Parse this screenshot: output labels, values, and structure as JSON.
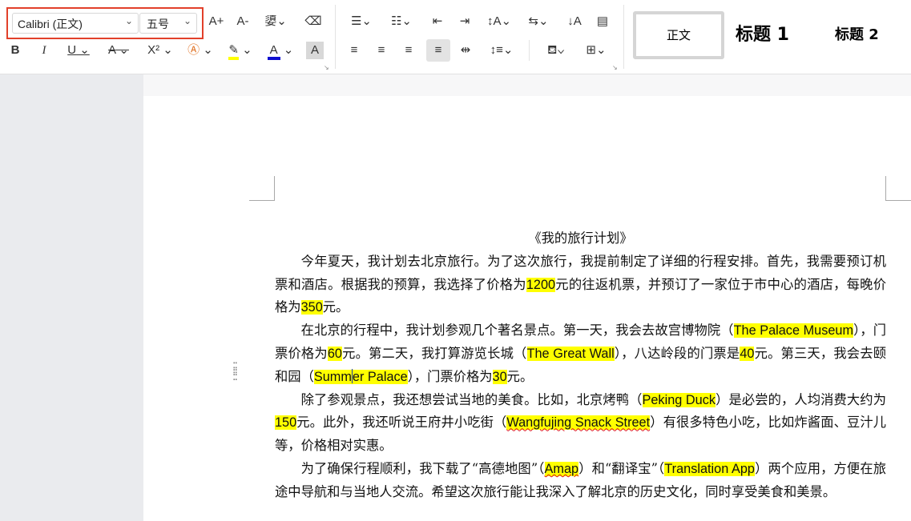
{
  "ribbon": {
    "font_name": "Calibri (正文)",
    "font_size": "五号",
    "grow_font_label": "A+",
    "shrink_font_label": "A-",
    "bold_label": "B",
    "italic_label": "I",
    "underline_label": "U",
    "strike_label": "A",
    "superscript_label": "X²",
    "font_color_label": "A",
    "char_shading_label": "A",
    "styles": [
      {
        "label": "正文"
      },
      {
        "label": "标题 1"
      },
      {
        "label": "标题 2"
      }
    ]
  },
  "document": {
    "title": "《我的旅行计划》",
    "p1": {
      "a": "今年夏天，我计划去北京旅行。为了这次旅行，我提前制定了详细的行程安排。首先，我需要预订机票和酒店。根据我的预算，我选择了价格为",
      "h1": "1200",
      "b": "元的往返机票，并预订了一家位于市中心的酒店，每晚价格为",
      "h2": "350",
      "c": "元。"
    },
    "p2": {
      "a": "在北京的行程中，我计划参观几个著名景点。第一天，我会去故宫博物院（",
      "h1": "The Palace Museum",
      "b": "），门票价格为",
      "h2": "60",
      "c": "元。第二天，我打算游览长城（",
      "h3": "The Great Wall",
      "d": "），八达岭段的门票是",
      "h4": "40",
      "e": "元。第三天，我会去颐和园（",
      "h5a": "Summ",
      "h5b": "er Palace",
      "f": "），门票价格为",
      "h6": "30",
      "g": "元。"
    },
    "p3": {
      "a": "除了参观景点，我还想尝试当地的美食。比如，北京烤鸭（",
      "h1": "Peking Duck",
      "b": "）是必尝的，人均消费大约为",
      "h2": "150",
      "c": "元。此外，我还听说王府井小吃街（",
      "h3": "Wangfujing Snack Street",
      "d": "）有很多特色小吃，比如炸酱面、豆汁儿等，价格相对实惠。"
    },
    "p4": {
      "a": "为了确保行程顺利，我下载了“高德地图”（",
      "h1": "Amap",
      "b": "）和“翻译宝”（",
      "h2": "Translation App",
      "c": "）两个应用，方便在旅途中导航和与当地人交流。希望这次旅行能让我深入了解北京的历史文化，同时享受美食和美景。"
    }
  },
  "colors": {
    "highlight": "#ffff00",
    "selection_border": "#e2402a",
    "font_color_bar": "#1010d0",
    "highlight_bar": "#ffff00"
  }
}
